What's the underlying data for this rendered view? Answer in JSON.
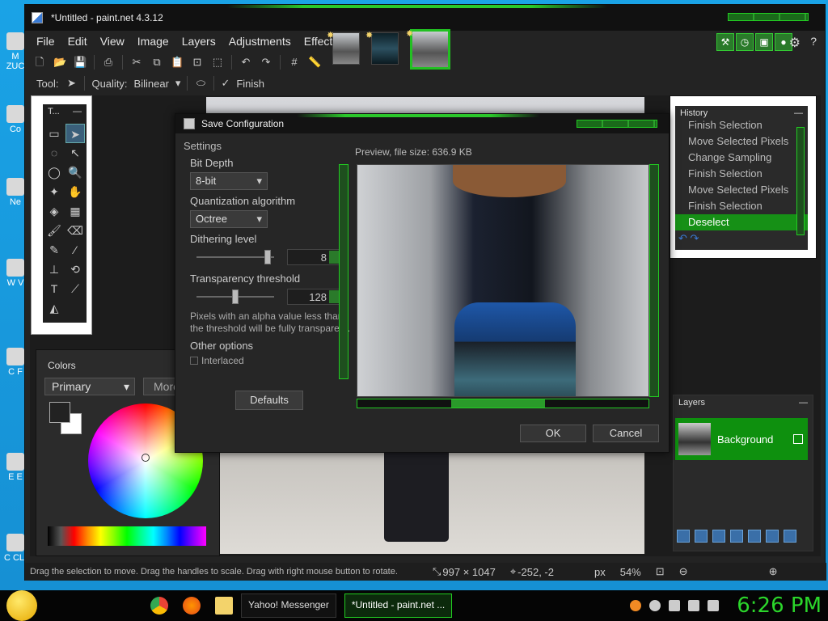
{
  "window": {
    "title": "*Untitled - paint.net 4.3.12",
    "menu": [
      "File",
      "Edit",
      "View",
      "Image",
      "Layers",
      "Adjustments",
      "Effects"
    ]
  },
  "options_bar": {
    "tool_label": "Tool:",
    "quality_label": "Quality:",
    "quality_value": "Bilinear",
    "finish_label": "Finish"
  },
  "tools_panel": {
    "title": "T..."
  },
  "colors_panel": {
    "title": "Colors",
    "primary_select": "Primary",
    "more_button": "More"
  },
  "history_panel": {
    "title": "History",
    "items": [
      {
        "label": "Finish Selection",
        "active": false
      },
      {
        "label": "Move Selected Pixels",
        "active": false
      },
      {
        "label": "Change Sampling",
        "active": false
      },
      {
        "label": "Finish Selection",
        "active": false
      },
      {
        "label": "Move Selected Pixels",
        "active": false
      },
      {
        "label": "Finish Selection",
        "active": false
      },
      {
        "label": "Deselect",
        "active": true
      }
    ]
  },
  "layers_panel": {
    "title": "Layers",
    "layers": [
      {
        "name": "Background"
      }
    ]
  },
  "dialog": {
    "title": "Save Configuration",
    "settings_header": "Settings",
    "bit_depth_label": "Bit Depth",
    "bit_depth_value": "8-bit",
    "quant_label": "Quantization algorithm",
    "quant_value": "Octree",
    "dither_label": "Dithering level",
    "dither_value": "8",
    "transparency_label": "Transparency threshold",
    "transparency_value": "128",
    "transparency_desc": "Pixels with an alpha value less than the threshold will be fully transparent.",
    "other_options_label": "Other options",
    "interlaced_label": "Interlaced",
    "defaults_button": "Defaults",
    "preview_label": "Preview, file size: 636.9 KB",
    "ok_button": "OK",
    "cancel_button": "Cancel"
  },
  "status_bar": {
    "message": "Drag the selection to move. Drag the handles to scale. Drag with right mouse button to rotate.",
    "size": "997 × 1047",
    "position": "-252, -2",
    "units": "px",
    "zoom": "54%"
  },
  "taskbar": {
    "tasks": [
      {
        "label": "Yahoo! Messenger",
        "active": false
      },
      {
        "label": "*Untitled - paint.net ...",
        "active": true
      }
    ],
    "clock": "6:26 PM"
  },
  "desktop_icons": [
    "M ZUC",
    "Co",
    "Ne",
    "W V",
    "C F",
    "E E",
    "C CLI"
  ],
  "colors": {
    "accent": "#22c022",
    "background": "#232323",
    "desktop": "#1aa3e6"
  }
}
